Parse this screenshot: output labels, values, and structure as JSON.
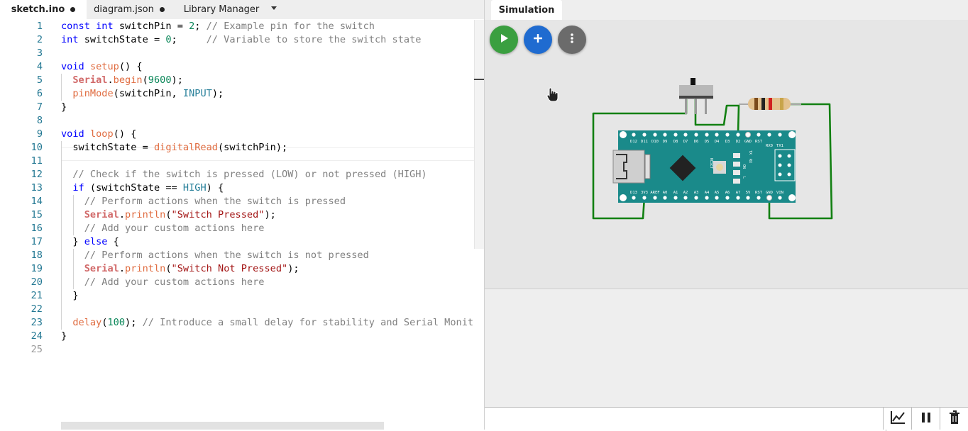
{
  "editor": {
    "tabs": [
      {
        "label": "sketch.ino",
        "modified": true,
        "active": true
      },
      {
        "label": "diagram.json",
        "modified": true,
        "active": false
      },
      {
        "label": "Library Manager",
        "modified": false,
        "active": false
      }
    ],
    "lines": [
      "const int switchPin = 2; // Example pin for the switch",
      "int switchState = 0;     // Variable to store the switch state",
      "",
      "void setup() {",
      "  Serial.begin(9600);",
      "  pinMode(switchPin, INPUT);",
      "}",
      "",
      "void loop() {",
      "  switchState = digitalRead(switchPin);",
      "",
      "  // Check if the switch is pressed (LOW) or not pressed (HIGH)",
      "  if (switchState == HIGH) {",
      "    // Perform actions when the switch is pressed",
      "    Serial.println(\"Switch Pressed\");",
      "    // Add your custom actions here",
      "  } else {",
      "    // Perform actions when the switch is not pressed",
      "    Serial.println(\"Switch Not Pressed\");",
      "    // Add your custom actions here",
      "  }",
      "",
      "  delay(100); // Introduce a small delay for stability and Serial Monit",
      "}",
      ""
    ],
    "line_numbers": [
      "1",
      "2",
      "3",
      "4",
      "5",
      "6",
      "7",
      "8",
      "9",
      "10",
      "11",
      "12",
      "13",
      "14",
      "15",
      "16",
      "17",
      "18",
      "19",
      "20",
      "21",
      "22",
      "23",
      "24",
      "25"
    ],
    "current_line": "9"
  },
  "simulation": {
    "tab_label": "Simulation",
    "play_icon": "play-icon",
    "add_icon": "plus-icon",
    "more_icon": "more-vertical-icon",
    "board": {
      "top_pins": [
        "D12",
        "D11",
        "D10",
        "D9",
        "D8",
        "D7",
        "D6",
        "D5",
        "D4",
        "D3",
        "D2",
        "GND",
        "RST",
        "RX0",
        "TX1"
      ],
      "bottom_pins": [
        "D13",
        "3V3",
        "AREF",
        "A0",
        "A1",
        "A2",
        "A3",
        "A4",
        "A5",
        "A6",
        "A7",
        "5V",
        "RST",
        "GND",
        "VIN"
      ],
      "leds": [
        "TX",
        "RX",
        "ON",
        "L"
      ],
      "reset_label": "RESET"
    },
    "colors": {
      "board": "#1a8a8a",
      "wire": "#128012",
      "play": "#3a9f40",
      "add": "#1f6bd0",
      "more": "#6b6b6b"
    }
  },
  "serial_monitor": {
    "input_value": "",
    "tools": [
      "chart-icon",
      "pause-icon",
      "trash-icon"
    ]
  }
}
